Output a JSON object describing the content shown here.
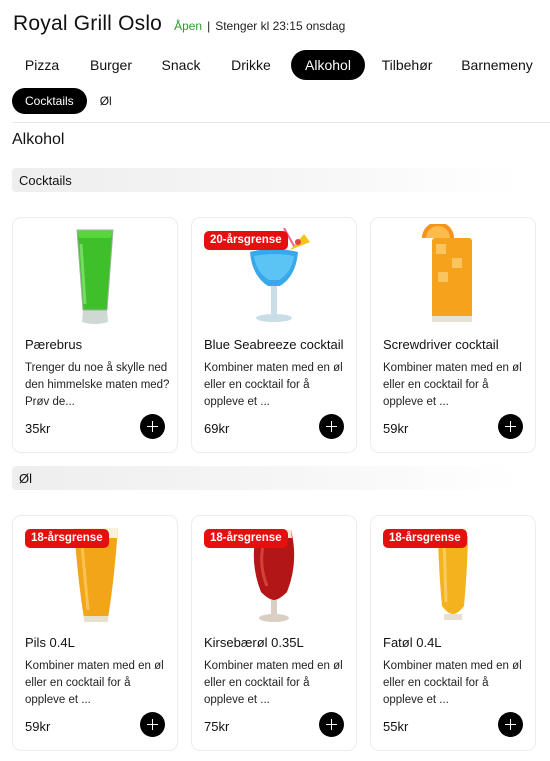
{
  "header": {
    "title": "Royal Grill Oslo",
    "status_open": "Åpen",
    "status_sep": "|",
    "status_close": "Stenger kl 23:15 onsdag"
  },
  "category_tabs": [
    {
      "label": "Pizza",
      "active": false
    },
    {
      "label": "Burger",
      "active": false
    },
    {
      "label": "Snack",
      "active": false
    },
    {
      "label": "Drikke",
      "active": false
    },
    {
      "label": "Alkohol",
      "active": true
    },
    {
      "label": "Tilbehør",
      "active": false
    },
    {
      "label": "Barnemeny",
      "active": false
    }
  ],
  "sub_tabs": [
    {
      "label": "Cocktails",
      "active": true
    },
    {
      "label": "Øl",
      "active": false
    }
  ],
  "section_title": "Alkohol",
  "groups": [
    {
      "title": "Cocktails",
      "items": [
        {
          "name": "Pærebrus",
          "badge": "",
          "description": "Trenger du noe å skylle ned den himmelske maten med? Prøv de...",
          "price": "35kr",
          "icon": "green-drink-glass-icon"
        },
        {
          "name": "Blue Seabreeze cocktail",
          "badge": "20-årsgrense",
          "description": "Kombiner maten med en øl eller en cocktail for å oppleve et ...",
          "price": "69kr",
          "icon": "blue-cocktail-glass-icon"
        },
        {
          "name": "Screwdriver cocktail",
          "badge": "",
          "description": "Kombiner maten med en øl eller en cocktail for å oppleve et ...",
          "price": "59kr",
          "icon": "orange-cocktail-glass-icon"
        }
      ]
    },
    {
      "title": "Øl",
      "items": [
        {
          "name": "Pils 0.4L",
          "badge": "18-årsgrense",
          "description": "Kombiner maten med en øl eller en cocktail for å oppleve et ...",
          "price": "59kr",
          "icon": "beer-glass-icon"
        },
        {
          "name": "Kirsebærøl 0.35L",
          "badge": "18-årsgrense",
          "description": "Kombiner maten med en øl eller en cocktail for å oppleve et ...",
          "price": "75kr",
          "icon": "cherry-beer-glass-icon"
        },
        {
          "name": "Fatøl 0.4L",
          "badge": "18-årsgrense",
          "description": "Kombiner maten med en øl eller en cocktail for å oppleve et ...",
          "price": "55kr",
          "icon": "draft-beer-glass-icon"
        }
      ]
    }
  ],
  "colors": {
    "open_status": "#2e9b2e",
    "badge": "#e50f0f",
    "active_tab": "#000000"
  }
}
